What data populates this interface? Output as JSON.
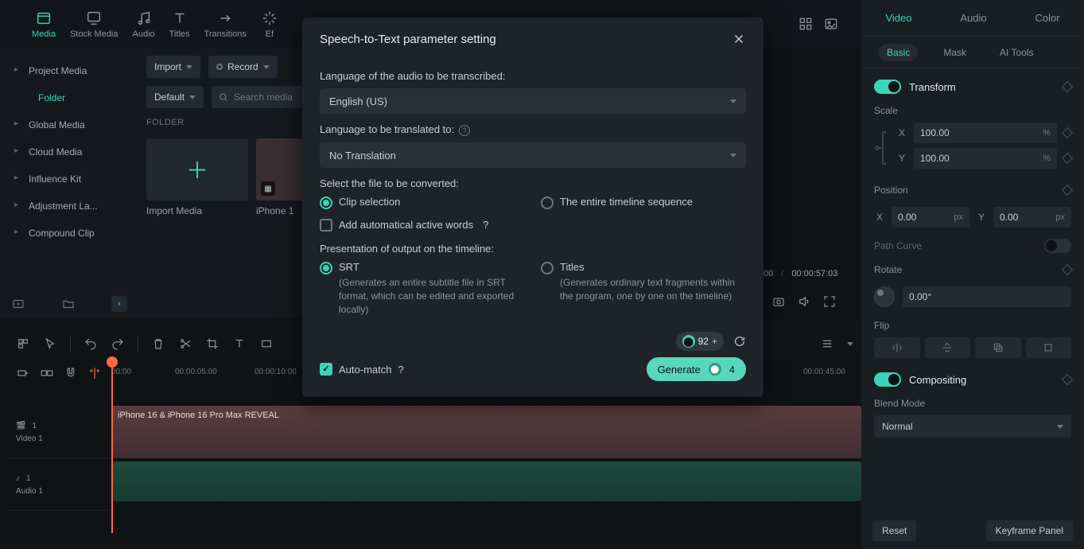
{
  "topnav": {
    "items": [
      "Media",
      "Stock Media",
      "Audio",
      "Titles",
      "Transitions",
      "Ef"
    ]
  },
  "left": {
    "items": [
      "Project Media",
      "Folder",
      "Global Media",
      "Cloud Media",
      "Influence Kit",
      "Adjustment La...",
      "Compound Clip"
    ]
  },
  "mediabar": {
    "import": "Import",
    "record": "Record",
    "default": "Default",
    "search_ph": "Search media",
    "folder": "FOLDER",
    "thumbs": [
      "Import Media",
      "iPhone 1"
    ]
  },
  "player": {
    "pos": "00",
    "dur": "00:00:57:03"
  },
  "ruler": [
    "00:00",
    "00:00:05:00",
    "00:00:10:00",
    "00:00:45:00"
  ],
  "tracks": {
    "v": {
      "idx": "1",
      "name": "Video 1",
      "clip": "iPhone 16 & iPhone 16 Pro Max REVEAL"
    },
    "a": {
      "idx": "1",
      "name": "Audio 1"
    }
  },
  "inspector": {
    "tabs": [
      "Video",
      "Audio",
      "Color"
    ],
    "subtabs": [
      "Basic",
      "Mask",
      "AI Tools"
    ],
    "transform": "Transform",
    "scale": "Scale",
    "scaleX": "100.00",
    "scaleY": "100.00",
    "position": "Position",
    "posX": "0.00",
    "posY": "0.00",
    "pathcurve": "Path Curve",
    "rotate": "Rotate",
    "rotdeg": "0.00°",
    "flip": "Flip",
    "compositing": "Compositing",
    "blendmode": "Blend Mode",
    "blendval": "Normal",
    "reset": "Reset",
    "kfpanel": "Keyframe Panel"
  },
  "modal": {
    "title": "Speech-to-Text parameter setting",
    "lang_label": "Language of the audio to be transcribed:",
    "lang_val": "English (US)",
    "trans_label": "Language to be translated to:",
    "trans_val": "No Translation",
    "select_label": "Select the file to be converted:",
    "opt_clip": "Clip selection",
    "opt_timeline": "The entire timeline sequence",
    "add_words": "Add automatical active words",
    "present_label": "Presentation of output on the timeline:",
    "srt_title": "SRT",
    "srt_desc": "(Generates an entire subtitle file in SRT format, which can be edited and exported locally)",
    "titles_title": "Titles",
    "titles_desc": "(Generates ordinary text fragments within the program, one by one on the timeline)",
    "automatch": "Auto-match",
    "credits": "92",
    "gen": "Generate",
    "gen_cost": "4"
  }
}
